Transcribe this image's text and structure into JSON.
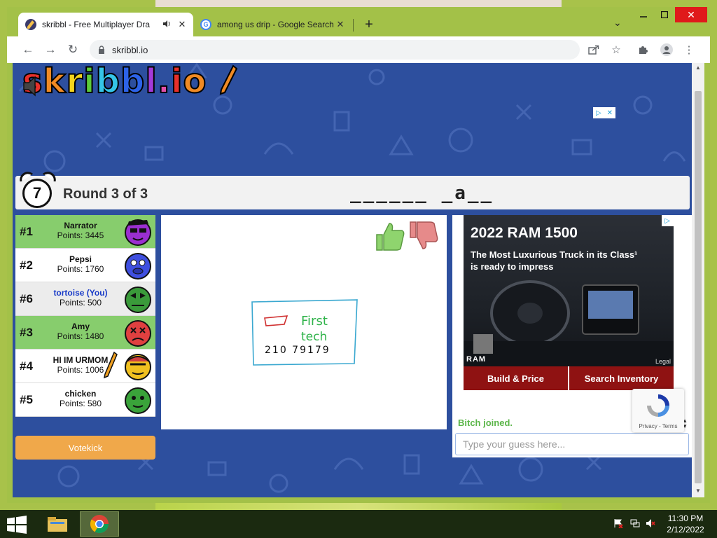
{
  "browser": {
    "tabs": [
      {
        "title": "skribbl - Free Multiplayer Dra",
        "active": true
      },
      {
        "title": "among us drip - Google Search",
        "active": false
      }
    ],
    "url": "skribbl.io"
  },
  "page": {
    "logo_letters": [
      "s",
      "k",
      "r",
      "i",
      "b",
      "b",
      "l",
      ".",
      "i",
      "o"
    ],
    "logo_colors": [
      "#e8302a",
      "#f08a24",
      "#f5d41c",
      "#5dcb3a",
      "#35c5e8",
      "#2d63e8",
      "#a43ad8",
      "#e04fa8",
      "#e8302a",
      "#f08a24"
    ],
    "timer": "7",
    "round": "Round 3 of 3",
    "word_hint": "______ _a__"
  },
  "players": [
    {
      "rank": "#1",
      "name": "Narrator",
      "points": "Points: 3445",
      "color": "#9b2fd0",
      "state": "guessed"
    },
    {
      "rank": "#2",
      "name": "Pepsi",
      "points": "Points: 1760",
      "color": "#3f4fe0",
      "state": "normal"
    },
    {
      "rank": "#6",
      "name": "tortoise (You)",
      "points": "Points: 500",
      "color": "#3a9a3a",
      "state": "you"
    },
    {
      "rank": "#3",
      "name": "Amy",
      "points": "Points: 1480",
      "color": "#e04040",
      "state": "guessed"
    },
    {
      "rank": "#4",
      "name": "HI IM URMOM",
      "points": "Points: 1006",
      "color": "#f0c020",
      "state": "drawing"
    },
    {
      "rank": "#5",
      "name": "chicken",
      "points": "Points: 580",
      "color": "#3aa33a",
      "state": "normal"
    }
  ],
  "votekick": "Votekick",
  "drawing": {
    "text_first": "First",
    "text_tech": "tech",
    "text_number": "210 79179"
  },
  "ad": {
    "headline": "2022 RAM 1500",
    "subline": "The Most Luxurious Truck in its Class¹ is ready to impress",
    "legal": "Legal",
    "brand": "RAM",
    "button_left": "Build & Price",
    "button_right": "Search Inventory"
  },
  "chat": {
    "message": "Bitch joined.",
    "placeholder": "Type your guess here..."
  },
  "recaptcha": {
    "terms": "Privacy - Terms"
  },
  "taskbar": {
    "time": "11:30 PM",
    "date": "2/12/2022"
  }
}
